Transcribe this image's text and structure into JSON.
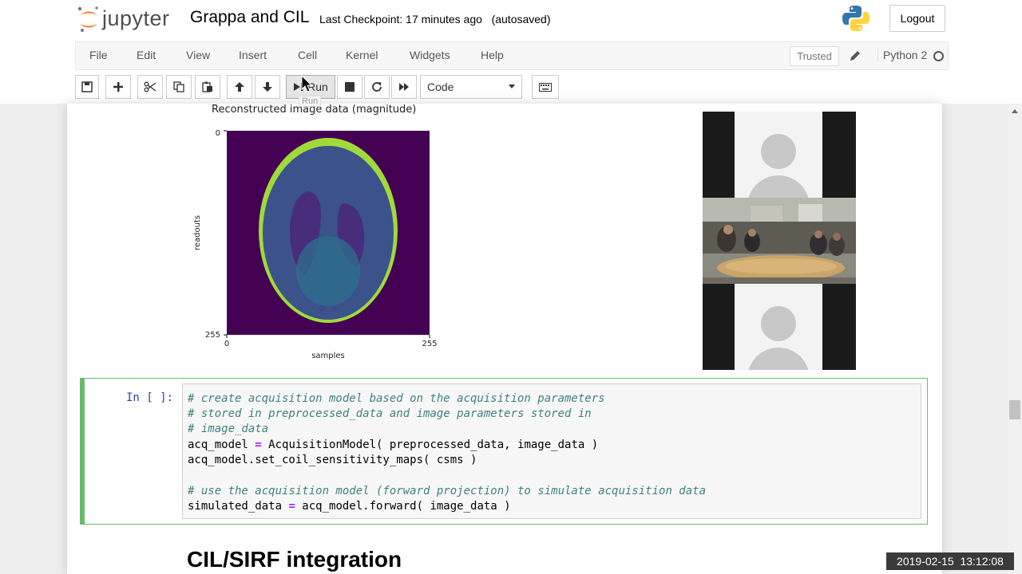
{
  "header": {
    "logo_text": "jupyter",
    "notebook_title": "Grappa and CIL",
    "checkpoint": "Last Checkpoint: 17 minutes ago   (autosaved)",
    "logout_label": "Logout"
  },
  "menubar": {
    "items": [
      "File",
      "Edit",
      "View",
      "Insert",
      "Cell",
      "Kernel",
      "Widgets",
      "Help"
    ],
    "trusted_label": "Trusted",
    "kernel_name": "Python 2"
  },
  "toolbar": {
    "run_label": "Run",
    "run_tooltip": "Run",
    "cell_type": "Code"
  },
  "output_plot": {
    "title": "Reconstructed image data (magnitude)",
    "xlabel": "samples",
    "ylabel": "readouts",
    "x_ticks": [
      "0",
      "255"
    ],
    "y_ticks": [
      "0",
      "255"
    ],
    "colors": {
      "background": "#440154",
      "tissue": "#3b528b",
      "rim": "#a0da39",
      "ventricle": "#472d7b",
      "center": "#2c728e"
    }
  },
  "code_cell": {
    "prompt": "In [ ]:",
    "lines": [
      "# create acquisition model based on the acquisition parameters",
      "# stored in preprocessed_data and image parameters stored in",
      "# image_data",
      "acq_model = AcquisitionModel( preprocessed_data, image_data )",
      "acq_model.set_coil_sensitivity_maps( csms )",
      "",
      "# use the acquisition model (forward projection) to simulate acquisition data",
      "simulated_data = acq_model.forward( image_data )"
    ]
  },
  "markdown": {
    "heading": "CIL/SIRF integration"
  },
  "overlay": {
    "timestamp": "2019-02-15  13:12:08"
  },
  "theme": {
    "accent_green": "#66bb6a",
    "prompt_blue": "#303f9f",
    "comment_color": "#408080",
    "operator_color": "#aa22ff"
  }
}
